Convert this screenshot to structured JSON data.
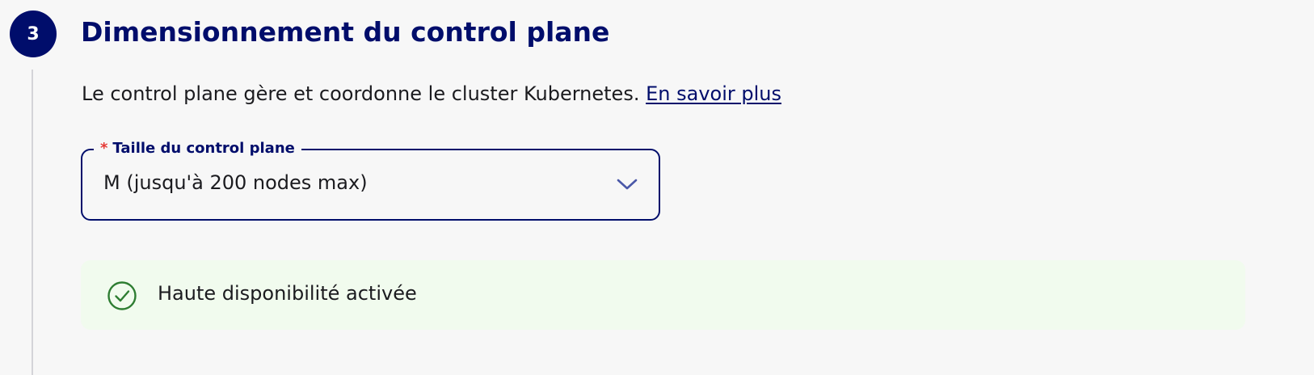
{
  "step": {
    "number": "3",
    "title": "Dimensionnement du control plane",
    "description": "Le control plane gère et coordonne le cluster Kubernetes.",
    "learn_more_link": "En savoir plus"
  },
  "control_plane_size": {
    "required_marker": "*",
    "label": "Taille du control plane",
    "selected_value": "M (jusqu'à 200 nodes max)",
    "chevron_icon": "chevron-down-icon"
  },
  "high_availability": {
    "icon": "check-circle-icon",
    "message": "Haute disponibilité activée"
  },
  "colors": {
    "primary": "#000d6b",
    "required": "#e53935",
    "success_bg": "#f1fbee",
    "success_icon": "#2e7d32",
    "text": "#1b1b1f",
    "rail": "#d4d4d8"
  }
}
